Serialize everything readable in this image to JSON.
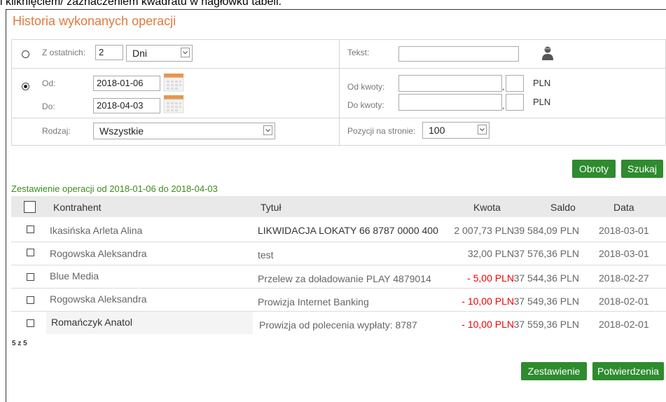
{
  "header_text": "i kliknięciem/ zaznaczeniem kwadratu w nagłówku tabeli.",
  "title": "Historia wykonanych operacji",
  "filters": {
    "last_label": "Z ostatnich:",
    "last_value": "2",
    "last_unit": "Dni",
    "text_label": "Tekst:",
    "text_value": "",
    "from_label": "Od:",
    "from_value": "2018-01-06",
    "to_label": "Do:",
    "to_value": "2018-04-03",
    "amount_from_label": "Od kwoty:",
    "amount_to_label": "Do kwoty:",
    "currency": "PLN",
    "comma": ",",
    "type_label": "Rodzaj:",
    "type_value": "Wszystkie",
    "per_page_label": "Pozycji na stronie:",
    "per_page_value": "100",
    "selected_mode": "date_range"
  },
  "buttons": {
    "turnover": "Obroty",
    "search": "Szukaj",
    "summary": "Zestawienie",
    "confirmations": "Potwierdzenia"
  },
  "summary_title": "Zestawienie operacji od 2018-01-06 do 2018-04-03",
  "table": {
    "headers": [
      "Kontrahent",
      "Tytuł",
      "Kwota",
      "Saldo",
      "Data"
    ],
    "rows": [
      {
        "contractor": "Ikasińska Arleta Alina",
        "title": "LIKWIDACJA LOKATY 66 8787 0000 400",
        "amount": "2 007,73 PLN",
        "negative": false,
        "balance": "39 584,09 PLN",
        "date": "2018-03-01"
      },
      {
        "contractor": "Rogowska Aleksandra",
        "title": "test",
        "amount": "32,00 PLN",
        "negative": false,
        "balance": "37 576,36 PLN",
        "date": "2018-03-01"
      },
      {
        "contractor": "Blue Media",
        "title": "Przelew za doładowanie PLAY 4879014",
        "amount": "- 5,00 PLN",
        "negative": true,
        "balance": "37 544,36 PLN",
        "date": "2018-02-27"
      },
      {
        "contractor": "Rogowska Aleksandra",
        "title": "Prowizja Internet Banking",
        "amount": "- 10,00 PLN",
        "negative": true,
        "balance": "37 549,36 PLN",
        "date": "2018-02-01"
      },
      {
        "contractor": "Romańczyk Anatol",
        "title": "Prowizja od polecenia wypłaty: 8787",
        "amount": "- 10,00 PLN",
        "negative": true,
        "balance": "37 559,36 PLN",
        "date": "2018-02-01"
      }
    ],
    "count_text": "5 z 5"
  },
  "colors": {
    "title": "#e07a3c",
    "accent_green": "#2e8b2e",
    "summary_green": "#3c8c1c",
    "negative": "#e00000",
    "calendar": "#e8964a"
  }
}
